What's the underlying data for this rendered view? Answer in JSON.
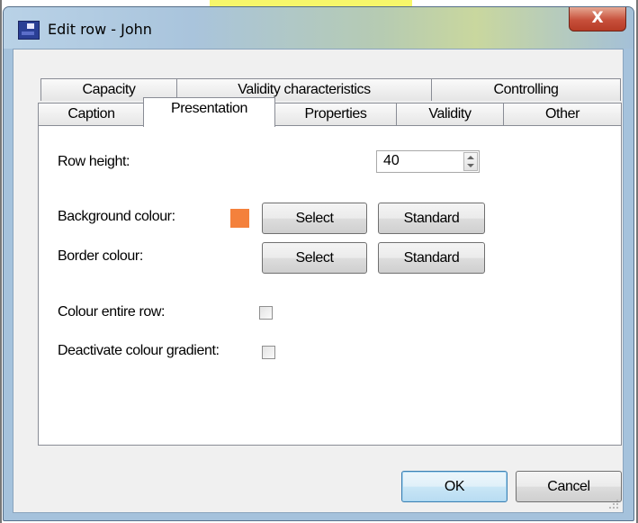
{
  "window": {
    "title": "Edit row - John",
    "close_glyph": "X"
  },
  "tabs": {
    "row1": [
      "Capacity",
      "Validity characteristics",
      "Controlling"
    ],
    "row2": [
      "Caption",
      "Presentation",
      "Properties",
      "Validity",
      "Other"
    ],
    "active": "Presentation"
  },
  "presentation": {
    "row_height_label": "Row height:",
    "row_height_value": "40",
    "background_colour_label": "Background colour:",
    "background_colour": "#f4813c",
    "border_colour_label": "Border colour:",
    "select_label": "Select",
    "standard_label": "Standard",
    "colour_entire_row_label": "Colour entire row:",
    "colour_entire_row_checked": false,
    "deactivate_gradient_label": "Deactivate colour gradient:",
    "deactivate_gradient_checked": false
  },
  "footer": {
    "ok_label": "OK",
    "cancel_label": "Cancel"
  },
  "icons": {
    "app": "app-icon",
    "close": "close-icon",
    "spinner_up": "chevron-up-icon",
    "spinner_down": "chevron-down-icon",
    "resize": "resize-grip-icon"
  }
}
